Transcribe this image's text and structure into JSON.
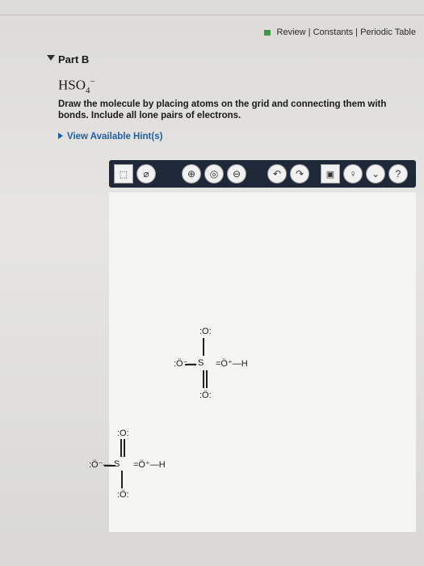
{
  "header": {
    "review": "Review",
    "sep": " | ",
    "constants": "Constants",
    "periodic": "Periodic Table"
  },
  "question": {
    "part": "Part B",
    "formula_main": "HSO",
    "formula_sub": "4",
    "formula_charge": "−",
    "instructions": "Draw the molecule by placing atoms on the grid and connecting them with bonds. Include all lone pairs of electrons.",
    "hint": "View Available Hint(s)"
  },
  "canvas": {
    "atom_o_top": ":O:",
    "atom_o_minus": ":Ö⁻—",
    "atom_s": "S",
    "atom_oh": "=Ö⁺—H",
    "atom_o_bottom": ":Ö:"
  },
  "colors": {
    "toolbar": "#1e2838",
    "hint_link": "#1f5fa8",
    "review_mark": "#3f9a45"
  }
}
